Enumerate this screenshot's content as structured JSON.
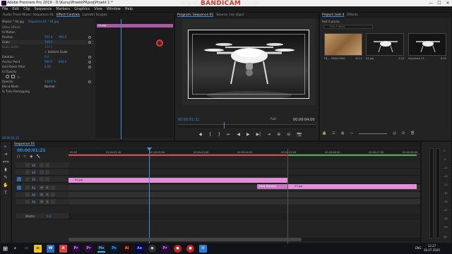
{
  "titlebar": {
    "title": "Adobe Premiere Pro 2019 - D:\\Kursy\\ProektPRproj\\Proekt 1 *",
    "minimize": "—",
    "maximize": "☐",
    "close": "✕"
  },
  "watermark": {
    "prefix": "www.",
    "brand": "BANDICAM",
    "suffix": ".com"
  },
  "menu": [
    "File",
    "Edit",
    "Clip",
    "Sequence",
    "Markers",
    "Graphics",
    "View",
    "Window",
    "Help"
  ],
  "effect_controls": {
    "tabs": [
      "Audio Track Mixer: Sequence 01",
      "Effect Controls",
      "Lumetri Scopes"
    ],
    "active_tab": "Effect Controls",
    "master_label": "Master * 04.jpg",
    "sequence_label": "Sequence 01 * 04.jpg",
    "section": "Video Effects",
    "rows": [
      {
        "name": "fx  Motion",
        "v1": "",
        "v2": ""
      },
      {
        "name": "Position",
        "v1": "555.4",
        "v2": "960.0"
      },
      {
        "name": "Scale",
        "v1": "108.0",
        "v2": ""
      },
      {
        "name": "Scale Width",
        "v1": "100.0",
        "v2": ""
      },
      {
        "name": "",
        "v1": "✓ Uniform Scale",
        "v2": ""
      },
      {
        "name": "Rotation",
        "v1": "0.0",
        "v2": ""
      },
      {
        "name": "Anchor Point",
        "v1": "960.0",
        "v2": "640.0"
      },
      {
        "name": "Anti-flicker Filter",
        "v1": "0.00",
        "v2": ""
      },
      {
        "name": "fx  Opacity",
        "v1": "",
        "v2": ""
      },
      {
        "name": "Opacity",
        "v1": "100.0 %",
        "v2": ""
      },
      {
        "name": "Blend Mode",
        "v1": "Normal",
        "v2": ""
      },
      {
        "name": "fx  Time Remapping",
        "v1": "",
        "v2": ""
      }
    ],
    "clip_label": "04.jpg",
    "timecode": "00:00:01:21"
  },
  "program_monitor": {
    "tabs": [
      "Program: Sequence 01",
      "Source: (no clips)"
    ],
    "active_tab": "Program: Sequence 01",
    "timecode": "00:00:01:21",
    "fit": "Full",
    "duration": "00:00:04:00",
    "controls": [
      "◆",
      "{",
      "}",
      "⇤",
      "◀",
      "▶",
      "▶|",
      "⇥",
      "⊕",
      "⊖",
      "📷"
    ]
  },
  "project": {
    "tabs": [
      "Project: test 4",
      "Effects"
    ],
    "active_tab": "Project: test 4",
    "path": "test 4.prproj",
    "search_placeholder": "Find 3 items",
    "items": [
      {
        "name": "FB_...3000x2000",
        "dur": "10:12"
      },
      {
        "name": "04.jpg",
        "dur": "4:29"
      },
      {
        "name": "Sequence 01",
        "dur": "8:03"
      }
    ]
  },
  "tools": [
    "▸",
    "⇥",
    "⟺",
    "⧫",
    "✎",
    "✋",
    "T"
  ],
  "timeline": {
    "tab": "Sequence 01",
    "timecode": "00:00:01:21",
    "ticks": [
      "00:00",
      "00:00:01:00",
      "00:00:02:00",
      "00:00:03:00",
      "00:00:04:00",
      "00:00:05:00",
      "00:00:06:00",
      "00:00:07:00",
      "00:00:08:00"
    ],
    "tracks": [
      "V3",
      "V2",
      "V1",
      "A1",
      "A2",
      "A3",
      "Master"
    ],
    "master_value": "0.0",
    "clip1": "04.jpg",
    "clip2": "07.jpg",
    "transition": "Cross Dissolve"
  },
  "meters": [
    "0",
    "-6",
    "-12",
    "-18",
    "-24",
    "-30",
    "-36",
    "-42",
    "-48",
    "-54",
    "dB"
  ],
  "taskbar": {
    "lang": "ENG",
    "time": "12:27",
    "date": "16.07.2020"
  }
}
